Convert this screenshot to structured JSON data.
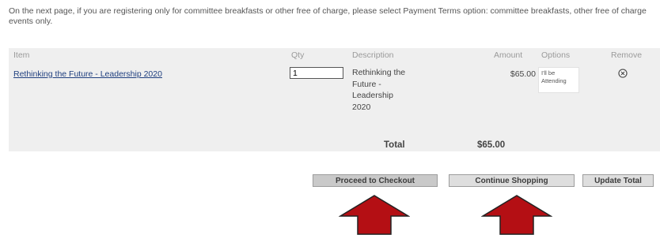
{
  "notice": "On the next page, if you are registering only for committee breakfasts or other free of charge, please select Payment Terms option: committee breakfasts, other free of charge events only.",
  "table": {
    "headers": {
      "item": "Item",
      "qty": "Qty",
      "description": "Description",
      "amount": "Amount",
      "options": "Options",
      "remove": "Remove"
    },
    "row": {
      "item": "Rethinking the Future - Leadership 2020",
      "qty": "1",
      "description": "Rethinking the Future - Leadership 2020",
      "amount": "$65.00",
      "options": "I'll be Attending",
      "remove_icon": "remove-circle-x-icon"
    },
    "total_label": "Total",
    "total_value": "$65.00"
  },
  "buttons": {
    "checkout": "Proceed to Checkout",
    "continue": "Continue Shopping",
    "update": "Update Total"
  },
  "colors": {
    "arrow": "#b40f14",
    "link": "#1f3f7f",
    "table_bg": "#efefef"
  },
  "annotation_icons": [
    "up-arrow-icon",
    "up-arrow-icon"
  ]
}
